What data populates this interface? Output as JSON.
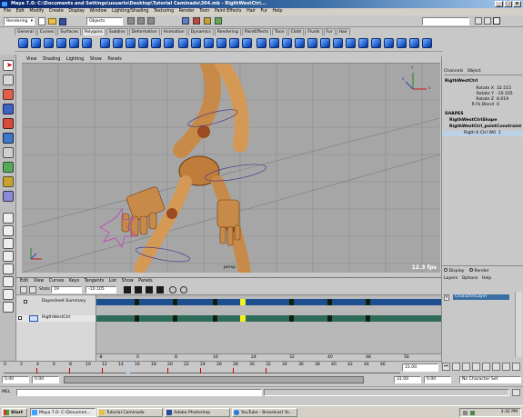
{
  "window": {
    "title": "Maya 7.0: C:\\Documents and Settings\\usuario\\Desktop\\Tutorial Caminado\\304.mb - RigthWestCtrl...",
    "min": "_",
    "max": "□",
    "close": "x"
  },
  "menubar": [
    "File",
    "Edit",
    "Modify",
    "Create",
    "Display",
    "Window",
    "Lighting/Shading",
    "Texturing",
    "Render",
    "Toon",
    "Paint Effects",
    "Hair",
    "Fur",
    "Help"
  ],
  "statusline": {
    "mode": "Rendering",
    "objects_label": "Objects"
  },
  "shelf_tabs": [
    "General",
    "Curves",
    "Surfaces",
    "Polygons",
    "Subdivs",
    "Deformation",
    "Animation",
    "Dynamics",
    "Rendering",
    "PaintEffects",
    "Toon",
    "Cloth",
    "Fluids",
    "Fur",
    "Hair",
    "Custom"
  ],
  "shelf_active_tab": "Polygons",
  "viewport": {
    "menu": [
      "View",
      "Shading",
      "Lighting",
      "Show",
      "Panels"
    ],
    "fps": "12.3 fps",
    "label_persp": "persp",
    "axis_x": "x",
    "axis_y": "y",
    "axis_z": "z"
  },
  "channel_box": {
    "tabs": [
      "Channels",
      "Object"
    ],
    "node": "RigthWestCtrl",
    "attributes": [
      {
        "name": "Rotate X",
        "value": "32.515"
      },
      {
        "name": "Rotate Y",
        "value": "-10.105"
      },
      {
        "name": "Rotate Z",
        "value": "8.019"
      },
      {
        "name": "R Fk Blend",
        "value": "0"
      }
    ],
    "shapes_header": "SHAPES",
    "shape1": "RigthWestCtrlShape",
    "shape2": "RigthWestCtrl_pointConstraint",
    "constraint_attr": {
      "name": "Rigth K Ctrl W0",
      "value": "1"
    }
  },
  "layer_editor": {
    "display_label": "Display",
    "render_label": "Render",
    "menu": [
      "Layers",
      "Options",
      "Help"
    ],
    "layer_v": "V",
    "layer_name": "CharacterLayer"
  },
  "graph_editor": {
    "menu": [
      "Edit",
      "View",
      "Curves",
      "Keys",
      "Tangents",
      "List",
      "Show",
      "Panels"
    ],
    "stats_label": "Stats",
    "stat_frame": "19",
    "stat_value": "-10.105",
    "rows": [
      "Dopesheet Summary",
      "RigthWestCtrl"
    ],
    "frames": [
      "-8",
      "0",
      "8",
      "16",
      "24",
      "32",
      "40",
      "48",
      "56"
    ]
  },
  "timeline": {
    "ticks": [
      "0",
      "2",
      "4",
      "6",
      "8",
      "10",
      "12",
      "14",
      "16",
      "18",
      "20",
      "22",
      "24",
      "26",
      "28",
      "30",
      "32",
      "34",
      "36",
      "38",
      "40",
      "42",
      "44",
      "46"
    ],
    "current_frame": "15.00"
  },
  "range": {
    "start": "0.00",
    "start2": "0.00",
    "end": "31.00",
    "end2": "0.00",
    "char_set": "No Character Set"
  },
  "cmdline": {
    "label": "MEL"
  },
  "taskbar": {
    "start": "Start",
    "tasks": [
      "Maya 7.0: C:\\Documen...",
      "Tutorial Caminado",
      "Adobe Photoshop",
      "YouTube - Broadcast Yo..."
    ],
    "clock": "3:32 PM"
  }
}
